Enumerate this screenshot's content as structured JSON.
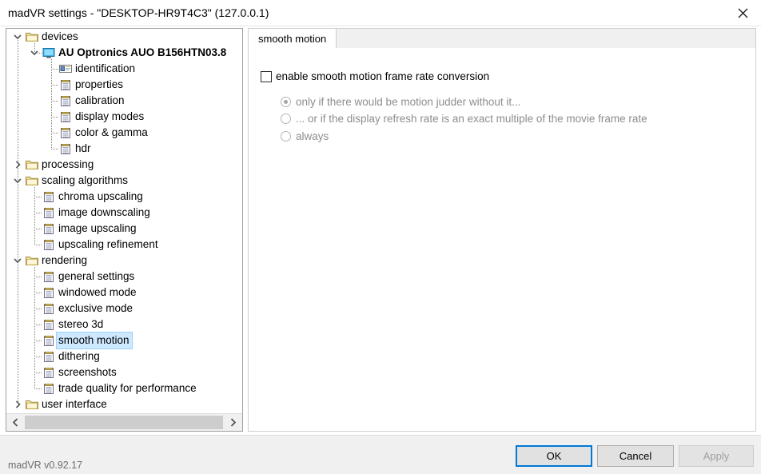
{
  "window": {
    "title": "madVR settings - \"DESKTOP-HR9T4C3\" (127.0.0.1)",
    "close_icon": "close-icon"
  },
  "tree": {
    "items": [
      {
        "label": "devices",
        "depth": 0,
        "type": "folder",
        "expander": "expanded",
        "bold": false,
        "selected": false
      },
      {
        "label": "AU Optronics AUO B156HTN03.8",
        "depth": 1,
        "type": "monitor",
        "expander": "expanded",
        "bold": true,
        "selected": false
      },
      {
        "label": "identification",
        "depth": 2,
        "type": "idcard",
        "expander": "none",
        "bold": false,
        "selected": false
      },
      {
        "label": "properties",
        "depth": 2,
        "type": "document",
        "expander": "none",
        "bold": false,
        "selected": false
      },
      {
        "label": "calibration",
        "depth": 2,
        "type": "document",
        "expander": "none",
        "bold": false,
        "selected": false
      },
      {
        "label": "display modes",
        "depth": 2,
        "type": "document",
        "expander": "none",
        "bold": false,
        "selected": false
      },
      {
        "label": "color & gamma",
        "depth": 2,
        "type": "document",
        "expander": "none",
        "bold": false,
        "selected": false
      },
      {
        "label": "hdr",
        "depth": 2,
        "type": "document",
        "expander": "none",
        "bold": false,
        "selected": false
      },
      {
        "label": "processing",
        "depth": 0,
        "type": "folder",
        "expander": "collapsed",
        "bold": false,
        "selected": false
      },
      {
        "label": "scaling algorithms",
        "depth": 0,
        "type": "folder",
        "expander": "expanded",
        "bold": false,
        "selected": false
      },
      {
        "label": "chroma upscaling",
        "depth": 1,
        "type": "document",
        "expander": "none",
        "bold": false,
        "selected": false
      },
      {
        "label": "image downscaling",
        "depth": 1,
        "type": "document",
        "expander": "none",
        "bold": false,
        "selected": false
      },
      {
        "label": "image upscaling",
        "depth": 1,
        "type": "document",
        "expander": "none",
        "bold": false,
        "selected": false
      },
      {
        "label": "upscaling refinement",
        "depth": 1,
        "type": "document",
        "expander": "none",
        "bold": false,
        "selected": false
      },
      {
        "label": "rendering",
        "depth": 0,
        "type": "folder",
        "expander": "expanded",
        "bold": false,
        "selected": false
      },
      {
        "label": "general settings",
        "depth": 1,
        "type": "document",
        "expander": "none",
        "bold": false,
        "selected": false
      },
      {
        "label": "windowed mode",
        "depth": 1,
        "type": "document",
        "expander": "none",
        "bold": false,
        "selected": false
      },
      {
        "label": "exclusive mode",
        "depth": 1,
        "type": "document",
        "expander": "none",
        "bold": false,
        "selected": false
      },
      {
        "label": "stereo 3d",
        "depth": 1,
        "type": "document",
        "expander": "none",
        "bold": false,
        "selected": false
      },
      {
        "label": "smooth motion",
        "depth": 1,
        "type": "document",
        "expander": "none",
        "bold": false,
        "selected": true
      },
      {
        "label": "dithering",
        "depth": 1,
        "type": "document",
        "expander": "none",
        "bold": false,
        "selected": false
      },
      {
        "label": "screenshots",
        "depth": 1,
        "type": "document",
        "expander": "none",
        "bold": false,
        "selected": false
      },
      {
        "label": "trade quality for performance",
        "depth": 1,
        "type": "document",
        "expander": "none",
        "bold": false,
        "selected": false
      },
      {
        "label": "user interface",
        "depth": 0,
        "type": "folder",
        "expander": "collapsed",
        "bold": false,
        "selected": false
      }
    ],
    "scrollbar": {
      "left_arrow_icon": "chevron-left-icon",
      "right_arrow_icon": "chevron-right-icon"
    }
  },
  "tabs": [
    {
      "label": "smooth motion",
      "active": true
    }
  ],
  "panel": {
    "checkbox": {
      "label": "enable smooth motion frame rate conversion",
      "checked": false
    },
    "radios": [
      {
        "label": "only if there would be motion judder without it...",
        "selected": true,
        "disabled": true
      },
      {
        "label": "... or if the display refresh rate is an exact multiple of the movie frame rate",
        "selected": false,
        "disabled": true
      },
      {
        "label": "always",
        "selected": false,
        "disabled": true
      }
    ]
  },
  "footer": {
    "version": "madVR v0.92.17",
    "ok_label": "OK",
    "cancel_label": "Cancel",
    "apply_label": "Apply"
  },
  "colors": {
    "selection": "#cde8ff",
    "focus_border": "#0078d7",
    "folder": "#f5e3a0",
    "monitor": "#4ab8f0",
    "disabled_text": "#8d8d8d"
  }
}
